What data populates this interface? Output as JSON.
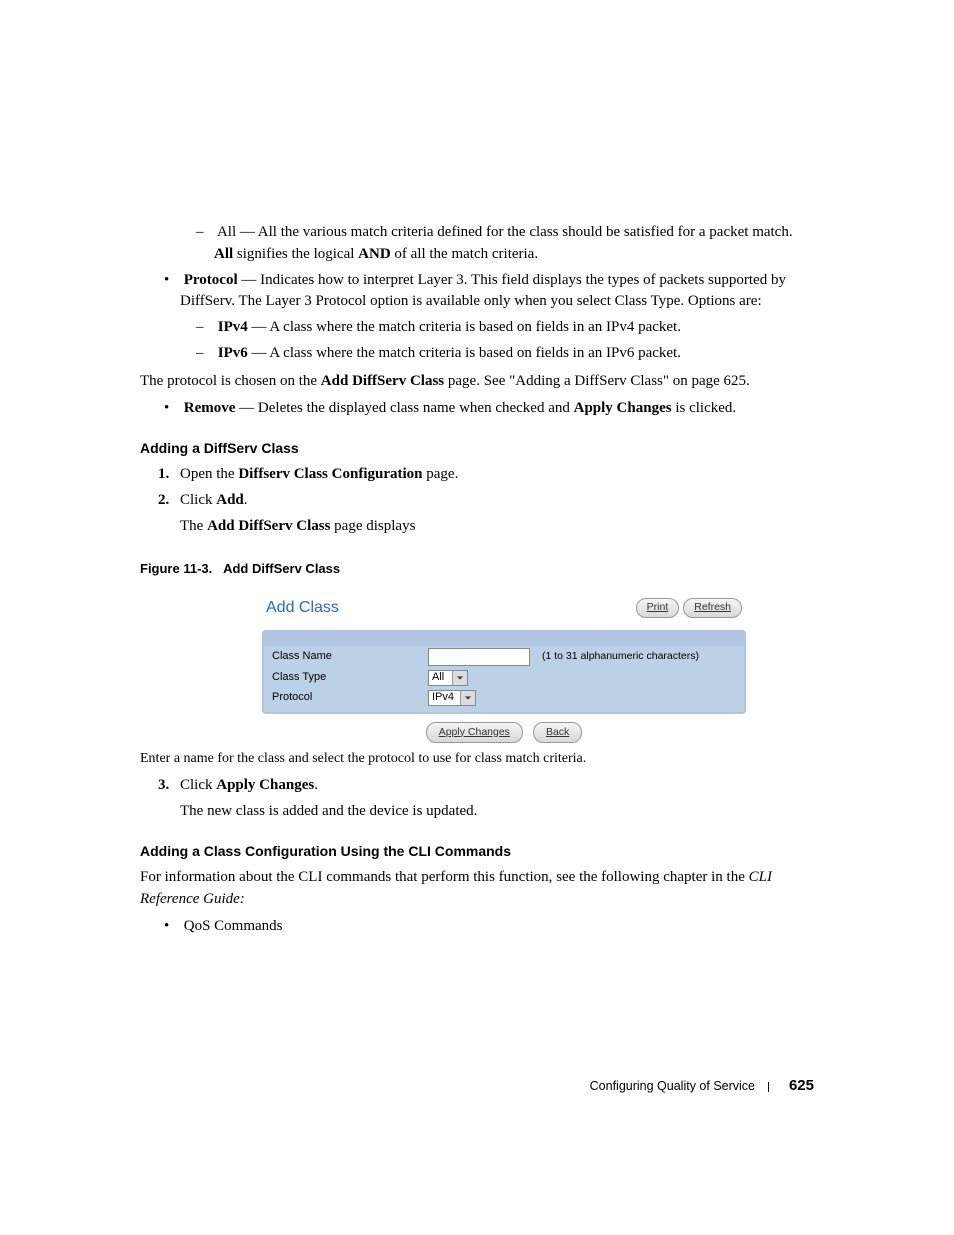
{
  "body": {
    "dash_all_prefix": "All",
    "dash_all_text": " — All the various match criteria defined for the class should be satisfied for a packet match. ",
    "dash_all_bold_tail": "All",
    "dash_all_text2": " signifies the logical ",
    "dash_all_bold_and": "AND",
    "dash_all_text3": " of all the match criteria.",
    "protocol_label": "Protocol",
    "protocol_text": " — Indicates how to interpret Layer 3. This field displays the types of packets supported by DiffServ. The Layer 3 Protocol option is available only when you select Class Type. Options are:",
    "ipv4_label": "IPv4",
    "ipv4_text": " — A class where the match criteria is based on fields in an IPv4 packet.",
    "ipv6_label": "IPv6",
    "ipv6_text": " — A class where the match criteria is based on fields in an IPv6 packet.",
    "proto_chosen_a": "The protocol is chosen on the ",
    "proto_chosen_b": "Add DiffServ Class",
    "proto_chosen_c": " page. See \"Adding a DiffServ Class\" on page 625.",
    "remove_label": "Remove",
    "remove_text_a": " — Deletes the displayed class name when checked and ",
    "remove_bold": "Apply Changes",
    "remove_text_b": " is clicked."
  },
  "sec1": {
    "heading": "Adding a DiffServ Class",
    "s1n": "1.",
    "s1a": "Open the ",
    "s1b": "Diffserv Class Configuration",
    "s1c": " page.",
    "s2n": "2.",
    "s2a": "Click ",
    "s2b": "Add",
    "s2c": ".",
    "s2d_a": "The ",
    "s2d_b": "Add DiffServ Class",
    "s2d_c": " page displays"
  },
  "fig": {
    "caption_pre": "Figure 11-3.",
    "caption": "Add DiffServ Class",
    "title": "Add Class",
    "print": "Print",
    "refresh": "Refresh",
    "class_name_label": "Class Name",
    "class_name_value": "",
    "class_name_hint": "(1 to 31 alphanumeric characters)",
    "class_type_label": "Class Type",
    "class_type_value": "All",
    "protocol_label": "Protocol",
    "protocol_value": "IPv4",
    "apply": "Apply Changes",
    "back": "Back"
  },
  "post": {
    "enter_name": "Enter a name for the class and select the protocol to use for class match criteria.",
    "s3n": "3.",
    "s3a": "Click ",
    "s3b": "Apply Changes",
    "s3c": ".",
    "s3d": "The new class is added and the device is updated."
  },
  "sec2": {
    "heading": "Adding a Class Configuration Using the CLI Commands",
    "p_a": "For information about the CLI commands that perform this function, see the following chapter in the ",
    "p_b": "CLI Reference Guide:",
    "bullet": "QoS Commands"
  },
  "footer": {
    "chapter": "Configuring Quality of Service",
    "page": "625"
  }
}
